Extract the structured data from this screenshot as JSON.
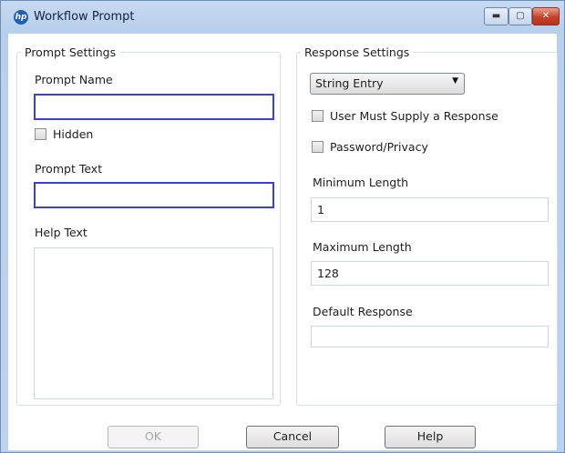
{
  "window": {
    "title": "Workflow Prompt",
    "icon_text": "hp",
    "minimize_glyph": "▬",
    "maximize_glyph": "▢",
    "close_glyph": "✕"
  },
  "prompt_settings": {
    "legend": "Prompt Settings",
    "prompt_name_label": "Prompt Name",
    "prompt_name_value": "",
    "hidden_label": "Hidden",
    "hidden_checked": false,
    "prompt_text_label": "Prompt Text",
    "prompt_text_value": "",
    "help_text_label": "Help Text",
    "help_text_value": ""
  },
  "response_settings": {
    "legend": "Response Settings",
    "type_value": "String Entry",
    "dropdown_arrow": "▼",
    "user_must_supply_label": "User Must Supply a Response",
    "user_must_supply_checked": false,
    "password_privacy_label": "Password/Privacy",
    "password_privacy_checked": false,
    "min_length_label": "Minimum Length",
    "min_length_value": "1",
    "max_length_label": "Maximum Length",
    "max_length_value": "128",
    "default_response_label": "Default Response",
    "default_response_value": ""
  },
  "buttons": {
    "ok": "OK",
    "cancel": "Cancel",
    "help": "Help"
  }
}
